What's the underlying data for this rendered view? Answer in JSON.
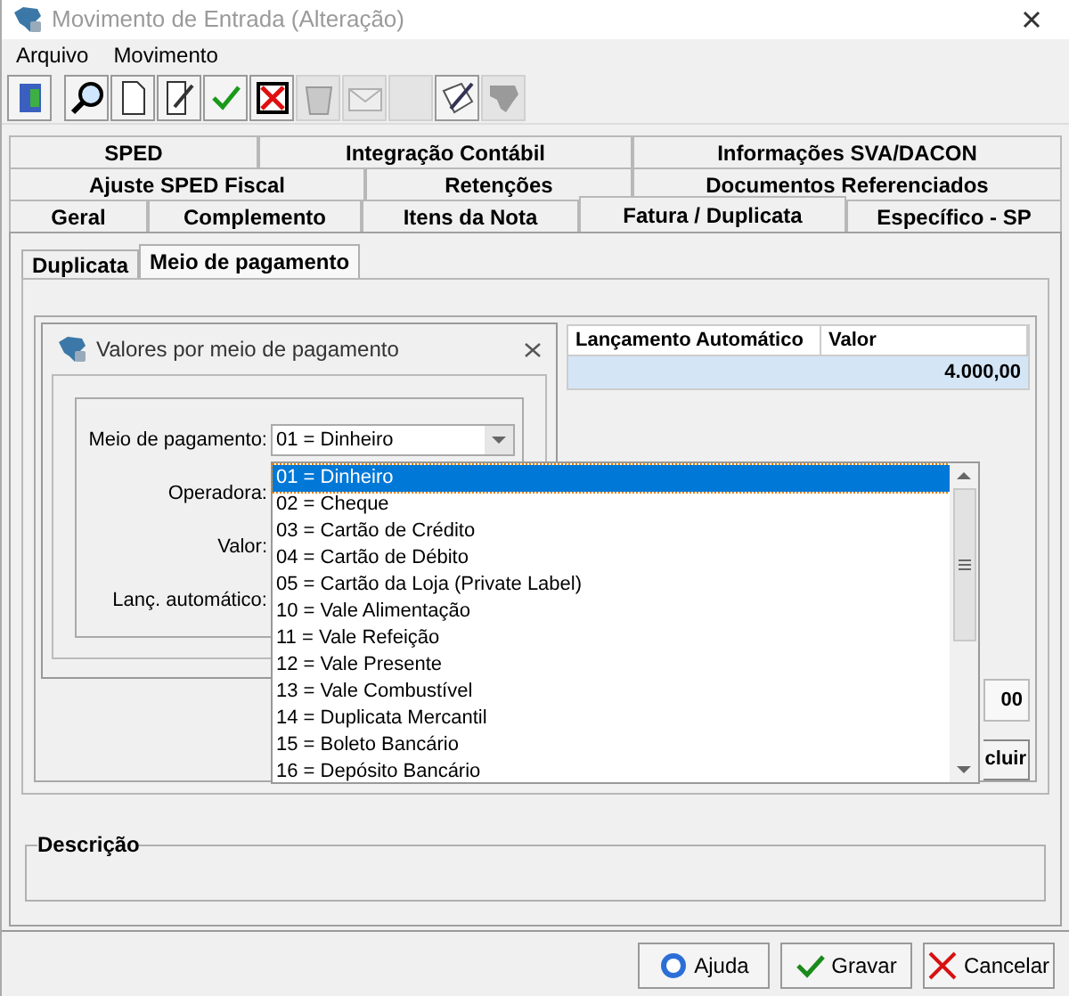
{
  "window": {
    "title": "Movimento de Entrada (Alteração)"
  },
  "menu": [
    "Arquivo",
    "Movimento"
  ],
  "toolbar": [
    {
      "kind": "door",
      "disabled": false
    },
    {
      "kind": "search",
      "disabled": false
    },
    {
      "kind": "page",
      "disabled": false
    },
    {
      "kind": "edit",
      "disabled": false
    },
    {
      "kind": "check",
      "disabled": false
    },
    {
      "kind": "delete",
      "disabled": false
    },
    {
      "kind": "recycle",
      "disabled": true
    },
    {
      "kind": "mail",
      "disabled": true
    },
    {
      "kind": "blank",
      "disabled": true
    },
    {
      "kind": "stamp",
      "disabled": false
    },
    {
      "kind": "map",
      "disabled": true
    }
  ],
  "tab_rows": [
    [
      {
        "label": "SPED",
        "selected": false
      },
      {
        "label": "Integração Contábil",
        "selected": false
      },
      {
        "label": "Informações SVA/DACON",
        "selected": false
      }
    ],
    [
      {
        "label": "Ajuste SPED Fiscal",
        "selected": false
      },
      {
        "label": "Retenções",
        "selected": false
      },
      {
        "label": "Documentos Referenciados",
        "selected": false
      }
    ],
    [
      {
        "label": "Geral",
        "selected": false
      },
      {
        "label": "Complemento",
        "selected": false
      },
      {
        "label": "Itens da Nota",
        "selected": false
      },
      {
        "label": "Fatura / Duplicata",
        "selected": true
      },
      {
        "label": "Específico - SP",
        "selected": false
      }
    ]
  ],
  "subtabs": [
    {
      "label": "Duplicata",
      "selected": false
    },
    {
      "label": "Meio de pagamento",
      "selected": true
    }
  ],
  "table": {
    "columns": [
      "Lançamento Automático",
      "Valor"
    ],
    "rows": [
      {
        "cells": [
          "",
          "4.000,00"
        ],
        "selected": true
      }
    ]
  },
  "total_field": {
    "value": "00"
  },
  "delete_button": {
    "label": "cluir"
  },
  "dialog": {
    "title": "Valores por meio de pagamento",
    "fields": [
      {
        "label": "Meio de pagamento:",
        "value": "01 = Dinheiro"
      },
      {
        "label": "Operadora:"
      },
      {
        "label": "Valor:"
      },
      {
        "label": "Lanç. automático:"
      }
    ],
    "dropdown": [
      {
        "label": "01 = Dinheiro",
        "selected": true
      },
      {
        "label": "02 = Cheque",
        "selected": false
      },
      {
        "label": "03 = Cartão de Crédito",
        "selected": false
      },
      {
        "label": "04 = Cartão de Débito",
        "selected": false
      },
      {
        "label": "05 = Cartão da Loja (Private Label)",
        "selected": false
      },
      {
        "label": "10 = Vale Alimentação",
        "selected": false
      },
      {
        "label": "11 = Vale Refeição",
        "selected": false
      },
      {
        "label": "12 = Vale Presente",
        "selected": false
      },
      {
        "label": "13 = Vale Combustível",
        "selected": false
      },
      {
        "label": "14 = Duplicata Mercantil",
        "selected": false
      },
      {
        "label": "15 = Boleto Bancário",
        "selected": false
      },
      {
        "label": "16 = Depósito Bancário",
        "selected": false
      }
    ]
  },
  "description": {
    "label": "Descrição"
  },
  "buttons": [
    {
      "kind": "help",
      "label": "Ajuda"
    },
    {
      "kind": "save",
      "label": "Gravar"
    },
    {
      "kind": "cancel",
      "label": "Cancelar"
    }
  ]
}
